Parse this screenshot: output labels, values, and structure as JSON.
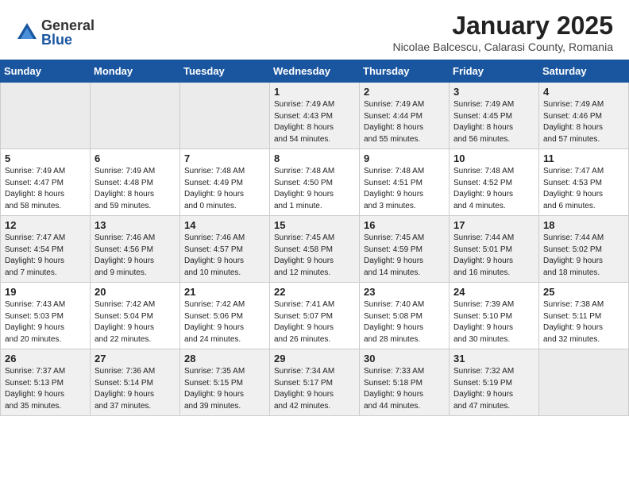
{
  "logo": {
    "general": "General",
    "blue": "Blue"
  },
  "title": {
    "month": "January 2025",
    "location": "Nicolae Balcescu, Calarasi County, Romania"
  },
  "weekdays": [
    "Sunday",
    "Monday",
    "Tuesday",
    "Wednesday",
    "Thursday",
    "Friday",
    "Saturday"
  ],
  "weeks": [
    [
      {
        "day": "",
        "info": ""
      },
      {
        "day": "",
        "info": ""
      },
      {
        "day": "",
        "info": ""
      },
      {
        "day": "1",
        "info": "Sunrise: 7:49 AM\nSunset: 4:43 PM\nDaylight: 8 hours\nand 54 minutes."
      },
      {
        "day": "2",
        "info": "Sunrise: 7:49 AM\nSunset: 4:44 PM\nDaylight: 8 hours\nand 55 minutes."
      },
      {
        "day": "3",
        "info": "Sunrise: 7:49 AM\nSunset: 4:45 PM\nDaylight: 8 hours\nand 56 minutes."
      },
      {
        "day": "4",
        "info": "Sunrise: 7:49 AM\nSunset: 4:46 PM\nDaylight: 8 hours\nand 57 minutes."
      }
    ],
    [
      {
        "day": "5",
        "info": "Sunrise: 7:49 AM\nSunset: 4:47 PM\nDaylight: 8 hours\nand 58 minutes."
      },
      {
        "day": "6",
        "info": "Sunrise: 7:49 AM\nSunset: 4:48 PM\nDaylight: 8 hours\nand 59 minutes."
      },
      {
        "day": "7",
        "info": "Sunrise: 7:48 AM\nSunset: 4:49 PM\nDaylight: 9 hours\nand 0 minutes."
      },
      {
        "day": "8",
        "info": "Sunrise: 7:48 AM\nSunset: 4:50 PM\nDaylight: 9 hours\nand 1 minute."
      },
      {
        "day": "9",
        "info": "Sunrise: 7:48 AM\nSunset: 4:51 PM\nDaylight: 9 hours\nand 3 minutes."
      },
      {
        "day": "10",
        "info": "Sunrise: 7:48 AM\nSunset: 4:52 PM\nDaylight: 9 hours\nand 4 minutes."
      },
      {
        "day": "11",
        "info": "Sunrise: 7:47 AM\nSunset: 4:53 PM\nDaylight: 9 hours\nand 6 minutes."
      }
    ],
    [
      {
        "day": "12",
        "info": "Sunrise: 7:47 AM\nSunset: 4:54 PM\nDaylight: 9 hours\nand 7 minutes."
      },
      {
        "day": "13",
        "info": "Sunrise: 7:46 AM\nSunset: 4:56 PM\nDaylight: 9 hours\nand 9 minutes."
      },
      {
        "day": "14",
        "info": "Sunrise: 7:46 AM\nSunset: 4:57 PM\nDaylight: 9 hours\nand 10 minutes."
      },
      {
        "day": "15",
        "info": "Sunrise: 7:45 AM\nSunset: 4:58 PM\nDaylight: 9 hours\nand 12 minutes."
      },
      {
        "day": "16",
        "info": "Sunrise: 7:45 AM\nSunset: 4:59 PM\nDaylight: 9 hours\nand 14 minutes."
      },
      {
        "day": "17",
        "info": "Sunrise: 7:44 AM\nSunset: 5:01 PM\nDaylight: 9 hours\nand 16 minutes."
      },
      {
        "day": "18",
        "info": "Sunrise: 7:44 AM\nSunset: 5:02 PM\nDaylight: 9 hours\nand 18 minutes."
      }
    ],
    [
      {
        "day": "19",
        "info": "Sunrise: 7:43 AM\nSunset: 5:03 PM\nDaylight: 9 hours\nand 20 minutes."
      },
      {
        "day": "20",
        "info": "Sunrise: 7:42 AM\nSunset: 5:04 PM\nDaylight: 9 hours\nand 22 minutes."
      },
      {
        "day": "21",
        "info": "Sunrise: 7:42 AM\nSunset: 5:06 PM\nDaylight: 9 hours\nand 24 minutes."
      },
      {
        "day": "22",
        "info": "Sunrise: 7:41 AM\nSunset: 5:07 PM\nDaylight: 9 hours\nand 26 minutes."
      },
      {
        "day": "23",
        "info": "Sunrise: 7:40 AM\nSunset: 5:08 PM\nDaylight: 9 hours\nand 28 minutes."
      },
      {
        "day": "24",
        "info": "Sunrise: 7:39 AM\nSunset: 5:10 PM\nDaylight: 9 hours\nand 30 minutes."
      },
      {
        "day": "25",
        "info": "Sunrise: 7:38 AM\nSunset: 5:11 PM\nDaylight: 9 hours\nand 32 minutes."
      }
    ],
    [
      {
        "day": "26",
        "info": "Sunrise: 7:37 AM\nSunset: 5:13 PM\nDaylight: 9 hours\nand 35 minutes."
      },
      {
        "day": "27",
        "info": "Sunrise: 7:36 AM\nSunset: 5:14 PM\nDaylight: 9 hours\nand 37 minutes."
      },
      {
        "day": "28",
        "info": "Sunrise: 7:35 AM\nSunset: 5:15 PM\nDaylight: 9 hours\nand 39 minutes."
      },
      {
        "day": "29",
        "info": "Sunrise: 7:34 AM\nSunset: 5:17 PM\nDaylight: 9 hours\nand 42 minutes."
      },
      {
        "day": "30",
        "info": "Sunrise: 7:33 AM\nSunset: 5:18 PM\nDaylight: 9 hours\nand 44 minutes."
      },
      {
        "day": "31",
        "info": "Sunrise: 7:32 AM\nSunset: 5:19 PM\nDaylight: 9 hours\nand 47 minutes."
      },
      {
        "day": "",
        "info": ""
      }
    ]
  ]
}
